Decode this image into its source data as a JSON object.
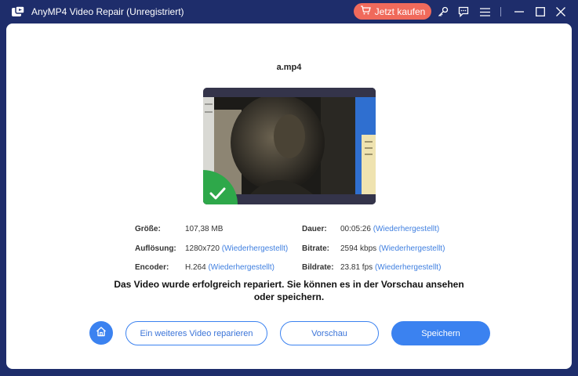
{
  "titlebar": {
    "title": "AnyMP4 Video Repair (Unregistriert)",
    "buy_label": "Jetzt kaufen",
    "icons": [
      "key-icon",
      "feedback-icon",
      "menu-icon",
      "minimize-icon",
      "maximize-icon",
      "close-icon"
    ]
  },
  "file": {
    "name": "a.mp4"
  },
  "info": {
    "size": {
      "label": "Größe:",
      "value": "107,38 MB"
    },
    "resolution": {
      "label": "Auflösung:",
      "value": "1280x720",
      "status": "(Wiederhergestellt)"
    },
    "encoder": {
      "label": "Encoder:",
      "value": "H.264",
      "status": "(Wiederhergestellt)"
    },
    "duration": {
      "label": "Dauer:",
      "value": "00:05:26",
      "status": "(Wiederhergestellt)"
    },
    "bitrate": {
      "label": "Bitrate:",
      "value": "2594 kbps",
      "status": "(Wiederhergestellt)"
    },
    "framerate": {
      "label": "Bildrate:",
      "value": "23.81 fps",
      "status": "(Wiederhergestellt)"
    }
  },
  "message": {
    "line1": "Das Video wurde erfolgreich repariert. Sie können es in der Vorschau ansehen",
    "line2": "oder speichern."
  },
  "actions": {
    "repair_another": "Ein weiteres Video reparieren",
    "preview": "Vorschau",
    "save": "Speichern"
  },
  "colors": {
    "titlebar": "#1e2d6b",
    "accent": "#3b82f0",
    "buy": "#f06a5b",
    "success": "#2ea84a"
  }
}
